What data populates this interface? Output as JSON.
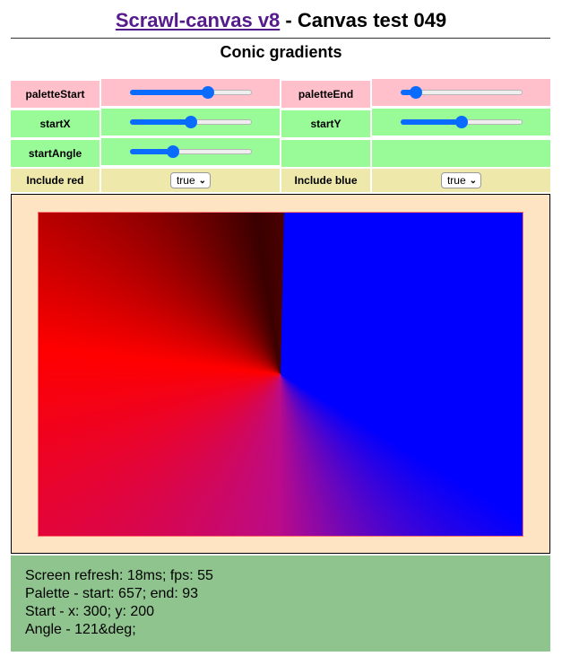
{
  "header": {
    "link_text": "Scrawl-canvas v8",
    "title_rest": " - Canvas test 049",
    "subtitle": "Conic gradients"
  },
  "controls": {
    "paletteStart": {
      "label": "paletteStart",
      "value_fraction": 0.66
    },
    "paletteEnd": {
      "label": "paletteEnd",
      "value_fraction": 0.09
    },
    "startX": {
      "label": "startX",
      "value_fraction": 0.5
    },
    "startY": {
      "label": "startY",
      "value_fraction": 0.5
    },
    "startAngle": {
      "label": "startAngle",
      "value_fraction": 0.34
    },
    "includeRed": {
      "label": "Include red",
      "value": "true"
    },
    "includeBlue": {
      "label": "Include blue",
      "value": "true"
    }
  },
  "colors": {
    "pink": "#ffc0cb",
    "green": "#98fb98",
    "khaki": "#eee8aa",
    "canvas_bg": "#ffe4c4",
    "report_bg": "#8fc48f",
    "accent": "#0a6bff"
  },
  "report": {
    "line1": "Screen refresh: 18ms; fps: 55",
    "line2": "Palette - start: 657; end: 93",
    "line3": "Start - x: 300; y: 200",
    "line4": "Angle - 121&deg;"
  }
}
